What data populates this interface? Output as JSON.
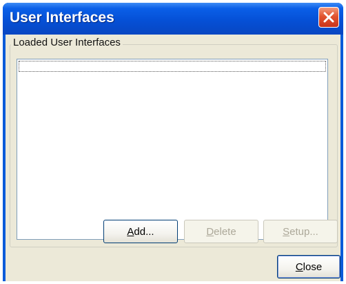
{
  "window": {
    "title": "User Interfaces"
  },
  "group": {
    "label": "Loaded User Interfaces"
  },
  "list": {
    "items": []
  },
  "buttons": {
    "add": {
      "mnemonic": "A",
      "rest": "dd..."
    },
    "delete": {
      "mnemonic": "D",
      "rest": "elete",
      "enabled": false
    },
    "setup": {
      "mnemonic": "S",
      "rest": "etup...",
      "enabled": false
    },
    "close": {
      "mnemonic": "C",
      "rest": "lose"
    }
  },
  "colors": {
    "titlebar": "#0550d6",
    "close_button": "#e2542f",
    "dialog_face": "#ece9d8"
  },
  "icons": {
    "close": "close-icon"
  }
}
